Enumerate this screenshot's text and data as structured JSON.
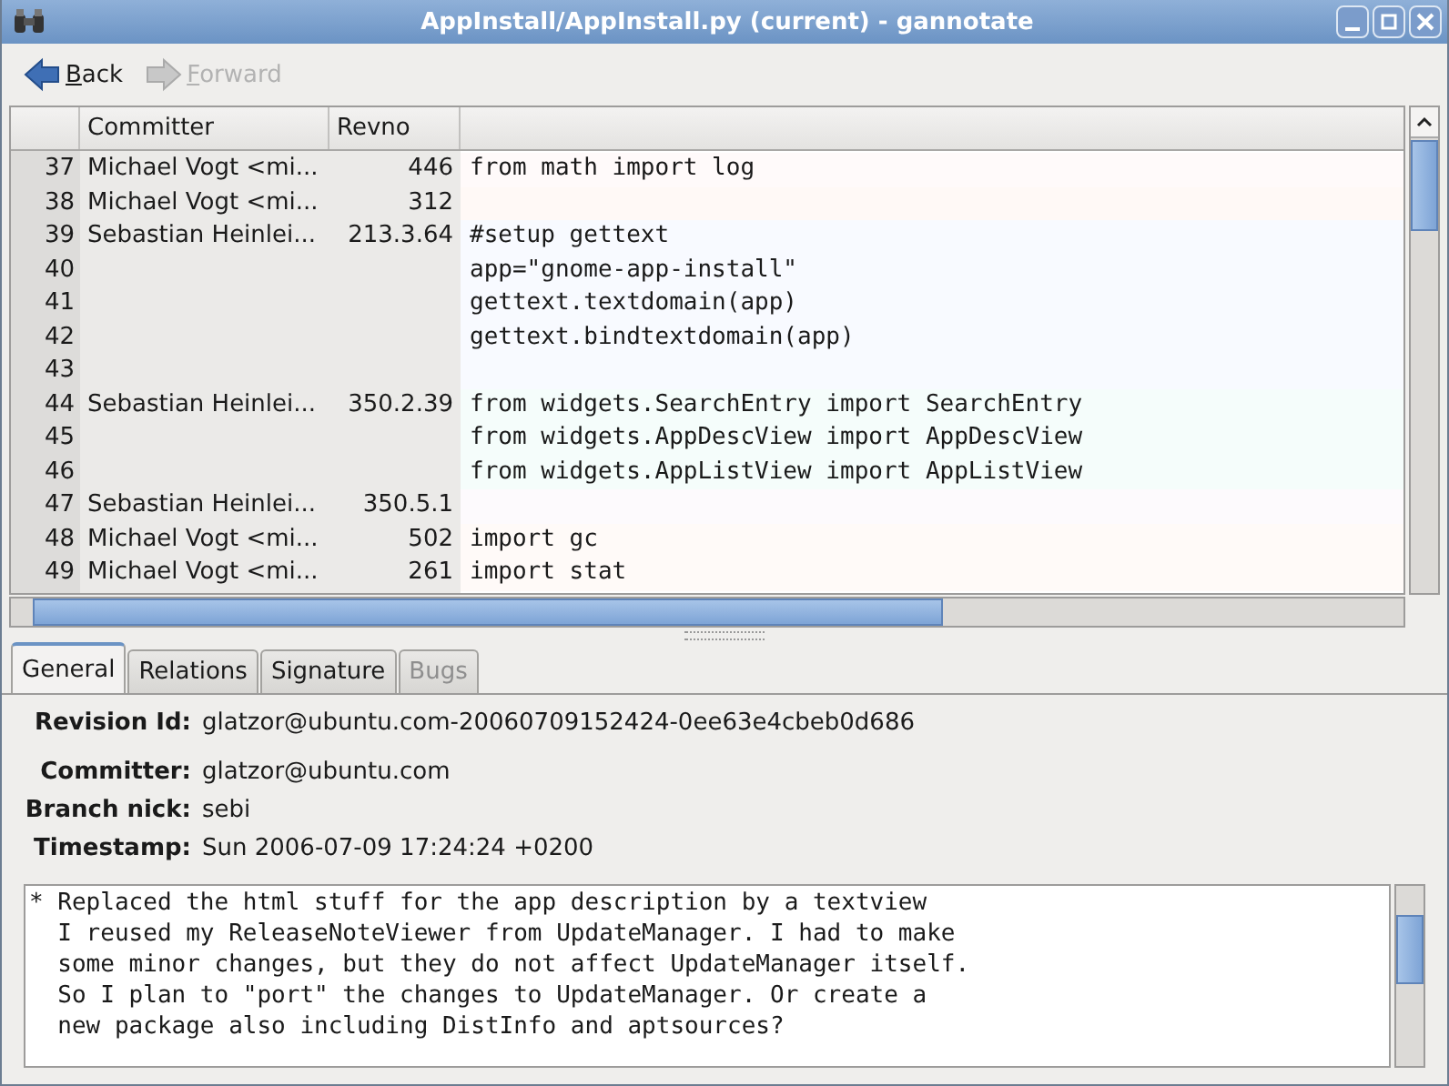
{
  "window": {
    "title": "AppInstall/AppInstall.py (current) - gannotate"
  },
  "toolbar": [
    {
      "label": "Back",
      "disabled": false
    },
    {
      "label": "Forward",
      "disabled": true
    }
  ],
  "table": {
    "columns": [
      "Committer",
      "Revno"
    ],
    "rows": [
      {
        "line": "37",
        "committer": "Michael Vogt <mi...",
        "revno": "446",
        "code": "from math import log",
        "color": "#fffafa"
      },
      {
        "line": "38",
        "committer": "Michael Vogt <mi...",
        "revno": "312",
        "code": "",
        "color": "#fff9f6"
      },
      {
        "line": "39",
        "committer": "Sebastian Heinlei...",
        "revno": "213.3.64",
        "code": "#setup gettext",
        "color": "#f8faff"
      },
      {
        "line": "40",
        "committer": "",
        "revno": "",
        "code": "app=\"gnome-app-install\"",
        "color": "#f8faff"
      },
      {
        "line": "41",
        "committer": "",
        "revno": "",
        "code": "gettext.textdomain(app)",
        "color": "#f8faff"
      },
      {
        "line": "42",
        "committer": "",
        "revno": "",
        "code": "gettext.bindtextdomain(app)",
        "color": "#f8faff"
      },
      {
        "line": "43",
        "committer": "",
        "revno": "",
        "code": "",
        "color": "#f8faff"
      },
      {
        "line": "44",
        "committer": "Sebastian Heinlei...",
        "revno": "350.2.39",
        "code": "from widgets.SearchEntry import SearchEntry",
        "color": "#f5fdfb"
      },
      {
        "line": "45",
        "committer": "",
        "revno": "",
        "code": "from widgets.AppDescView import AppDescView",
        "color": "#f5fdfb"
      },
      {
        "line": "46",
        "committer": "",
        "revno": "",
        "code": "from widgets.AppListView import AppListView",
        "color": "#f5fdfb"
      },
      {
        "line": "47",
        "committer": "Sebastian Heinlei...",
        "revno": "350.5.1",
        "code": "",
        "color": "#fdfafd"
      },
      {
        "line": "48",
        "committer": "Michael Vogt <mi...",
        "revno": "502",
        "code": "import gc",
        "color": "#fffaf8"
      },
      {
        "line": "49",
        "committer": "Michael Vogt <mi...",
        "revno": "261",
        "code": "import stat",
        "color": "#fffaf8"
      }
    ]
  },
  "tabs": [
    {
      "label": "General",
      "selected": true,
      "disabled": false
    },
    {
      "label": "Relations",
      "selected": false,
      "disabled": false
    },
    {
      "label": "Signature",
      "selected": false,
      "disabled": false
    },
    {
      "label": "Bugs",
      "selected": false,
      "disabled": true
    }
  ],
  "details": [
    {
      "label": "Revision Id:",
      "value": "glatzor@ubuntu.com-20060709152424-0ee63e4cbeb0d686"
    },
    {
      "label": "Committer:",
      "value": "glatzor@ubuntu.com"
    },
    {
      "label": "Branch nick:",
      "value": "sebi"
    },
    {
      "label": "Timestamp:",
      "value": "Sun 2006-07-09 17:24:24 +0200"
    }
  ],
  "message": [
    "* Replaced the html stuff for the app description by a textview",
    "  I reused my ReleaseNoteViewer from UpdateManager. I had to make",
    "  some minor changes, but they do not affect UpdateManager itself.",
    "  So I plan to \"port\" the changes to UpdateManager. Or create a",
    "  new package also including DistInfo and aptsources?"
  ]
}
